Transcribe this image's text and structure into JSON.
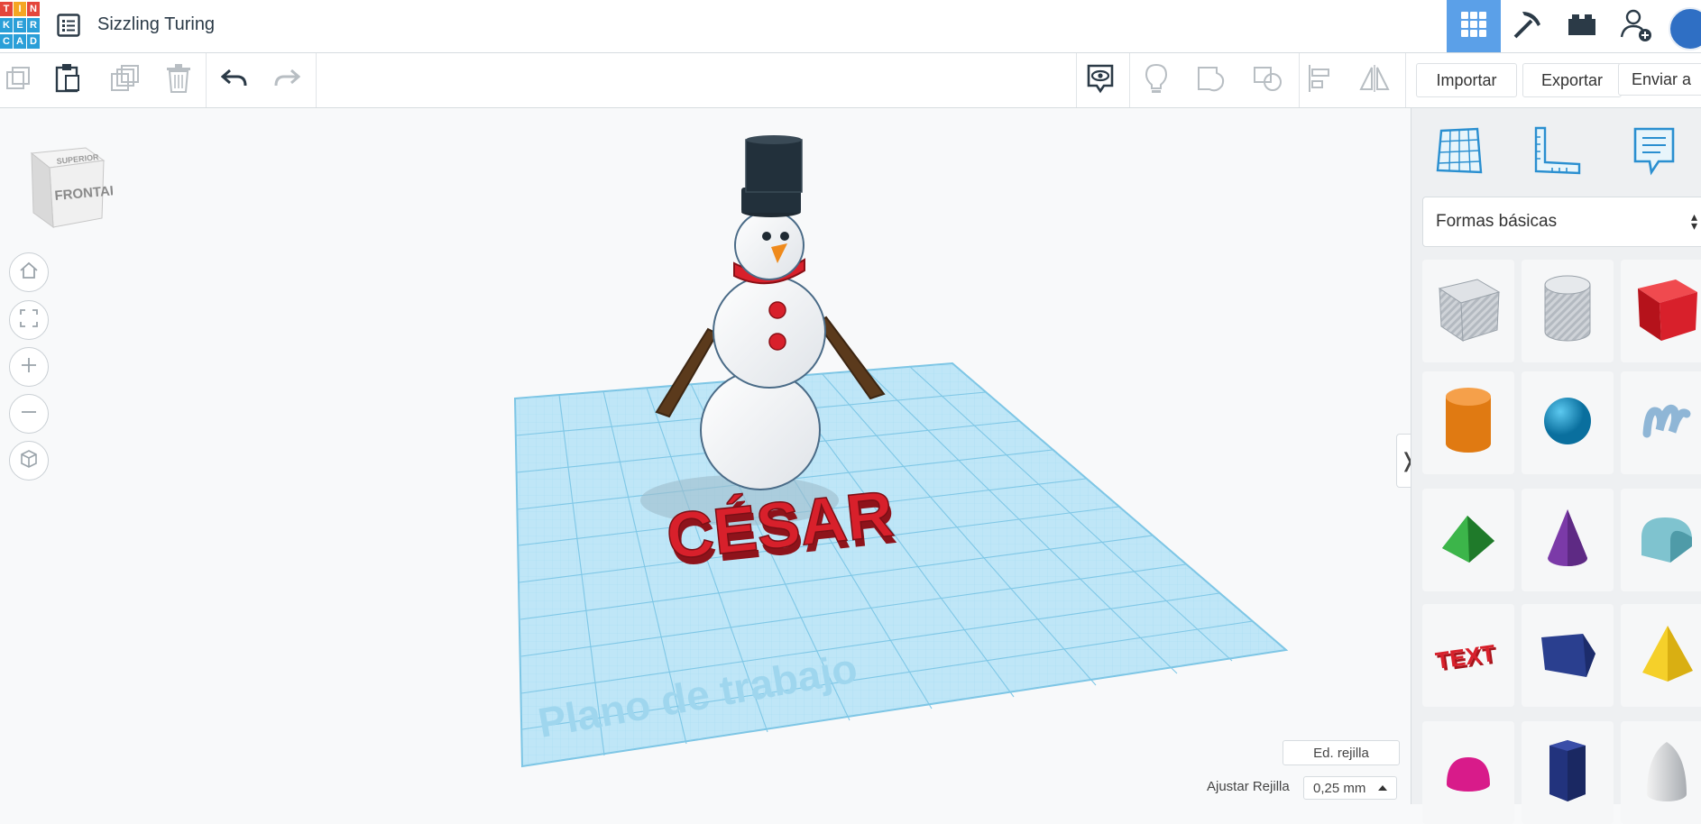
{
  "app": {
    "logo_letters": [
      "T",
      "I",
      "N",
      "K",
      "E",
      "R",
      "C",
      "A",
      "D"
    ],
    "title": "Sizzling Turing"
  },
  "toolbar": {
    "import_label": "Importar",
    "export_label": "Exportar",
    "send_label": "Enviar a"
  },
  "viewcube": {
    "top_label": "SUPERIOR",
    "front_label": "FRONTAL"
  },
  "scene": {
    "workplane_label": "Plano de trabajo",
    "text_object": "CÉSAR"
  },
  "workplane_controls": {
    "edit_grid_label": "Ed. rejilla",
    "snap_grid_label": "Ajustar Rejilla",
    "snap_grid_value": "0,25 mm"
  },
  "panel": {
    "category_select": "Formas básicas",
    "shapes": [
      {
        "name": "box-hole-icon"
      },
      {
        "name": "cylinder-hole-icon"
      },
      {
        "name": "box-icon"
      },
      {
        "name": "cylinder-icon"
      },
      {
        "name": "sphere-icon"
      },
      {
        "name": "scribble-icon"
      },
      {
        "name": "roof-icon"
      },
      {
        "name": "cone-icon"
      },
      {
        "name": "round-roof-icon"
      },
      {
        "name": "text-icon"
      },
      {
        "name": "polygon-icon"
      },
      {
        "name": "pyramid-icon"
      },
      {
        "name": "half-sphere-icon"
      },
      {
        "name": "prism-icon"
      },
      {
        "name": "paraboloid-icon"
      }
    ],
    "text_shape_label": "TEXT"
  },
  "colors": {
    "active_tab": "#5ba0e8",
    "grid_blue": "#7cc7ea",
    "red": "#d8202b"
  }
}
